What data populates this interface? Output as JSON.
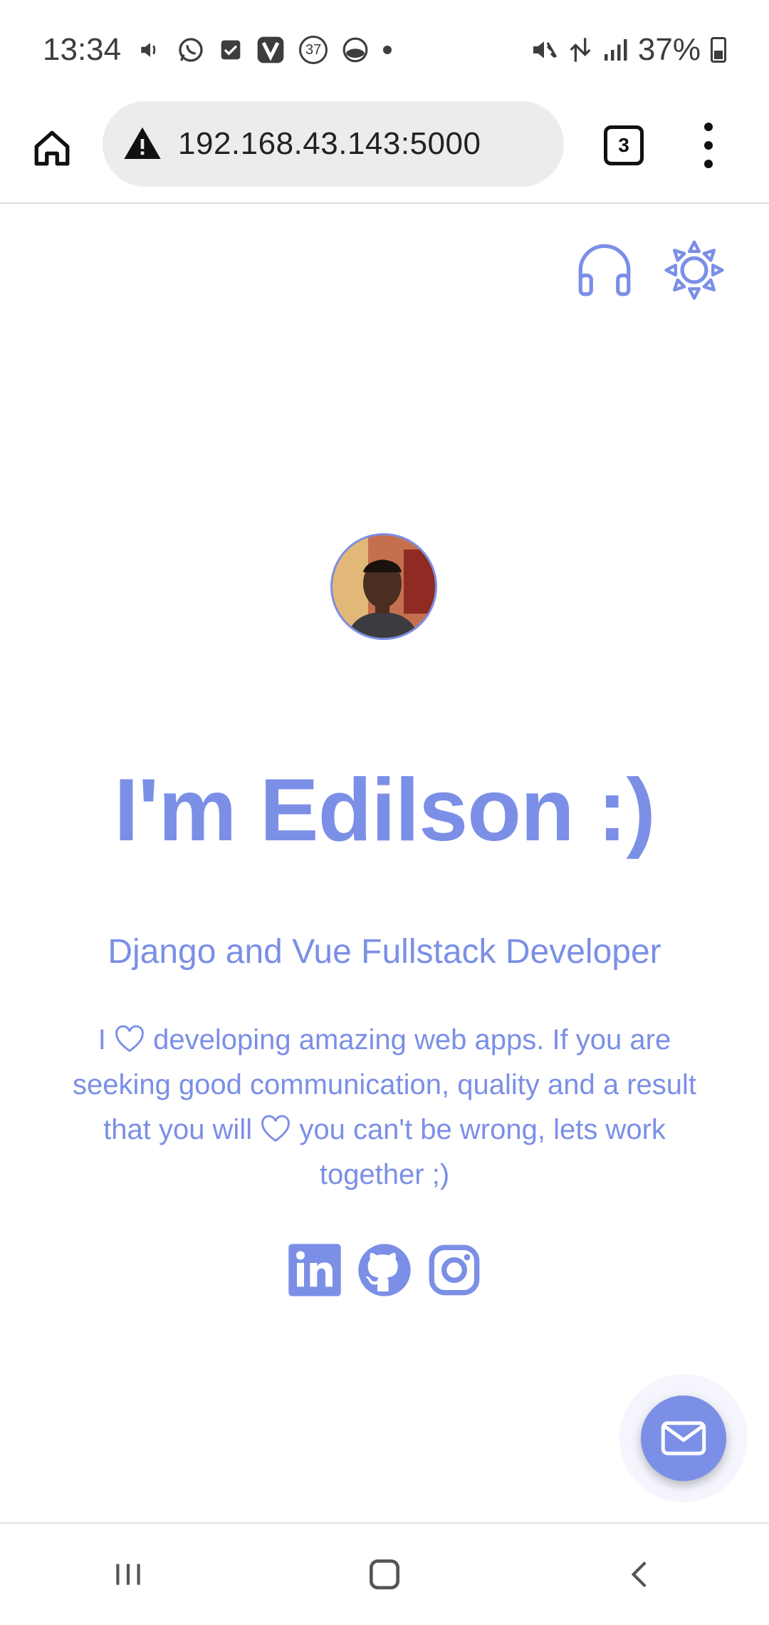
{
  "status_bar": {
    "time": "13:34",
    "battery": "37%",
    "notification_badge": "37",
    "icons_left": [
      "volume-icon",
      "whatsapp-icon",
      "checkbox-icon",
      "vivaldi-icon",
      "badge-icon",
      "browser-icon",
      "dot-icon"
    ],
    "icons_right": [
      "mute-icon",
      "data-icon",
      "signal-icon",
      "battery-icon"
    ]
  },
  "browser": {
    "url": "192.168.43.143:5000",
    "tab_count": "3"
  },
  "page": {
    "headline": "I'm Edilson :)",
    "subtitle": "Django and Vue Fullstack Developer",
    "bio": {
      "part1": "I ",
      "part2": " developing amazing web apps. If you are seeking good communication, quality and a result that you will ",
      "part3": " you can't be wrong, lets work together ;)"
    },
    "social": [
      "linkedin-icon",
      "github-icon",
      "instagram-icon"
    ]
  },
  "colors": {
    "accent": "#7b8fe6",
    "status_text": "#3d3d3d",
    "url_pill": "#ececec"
  }
}
